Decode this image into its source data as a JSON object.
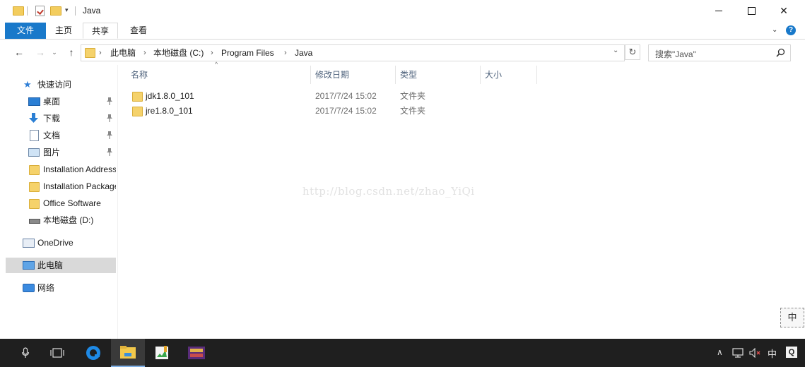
{
  "window": {
    "title": "Java",
    "controls": {
      "minimize": "─",
      "maximize": "☐",
      "close": "✕"
    }
  },
  "ribbon": {
    "tabs": [
      {
        "label": "文件",
        "active": true
      },
      {
        "label": "主页"
      },
      {
        "label": "共享"
      },
      {
        "label": "查看"
      }
    ],
    "help": "?"
  },
  "address": {
    "crumbs": [
      "此电脑",
      "本地磁盘 (C:)",
      "Program Files",
      "Java"
    ],
    "search_placeholder": "搜索\"Java\""
  },
  "nav": {
    "quick_access": "快速访问",
    "items": [
      {
        "label": "桌面",
        "icon": "desktop-icon",
        "pinned": true
      },
      {
        "label": "下载",
        "icon": "download-icon",
        "pinned": true
      },
      {
        "label": "文档",
        "icon": "document-icon",
        "pinned": true
      },
      {
        "label": "图片",
        "icon": "picture-icon",
        "pinned": true
      },
      {
        "label": "Installation Address",
        "icon": "folder-icon"
      },
      {
        "label": "Installation Package",
        "icon": "folder-icon"
      },
      {
        "label": "Office Software",
        "icon": "folder-icon"
      },
      {
        "label": "本地磁盘 (D:)",
        "icon": "drive-icon"
      }
    ],
    "onedrive": "OneDrive",
    "this_pc": "此电脑",
    "network": "网络"
  },
  "list": {
    "columns": [
      "名称",
      "修改日期",
      "类型",
      "大小"
    ],
    "rows": [
      {
        "name": "jdk1.8.0_101",
        "date": "2017/7/24 15:02",
        "type": "文件夹",
        "size": ""
      },
      {
        "name": "jre1.8.0_101",
        "date": "2017/7/24 15:02",
        "type": "文件夹",
        "size": ""
      }
    ]
  },
  "watermark": "http://blog.csdn.net/zhao_YiQi",
  "ime_badge": "中",
  "taskbar": {
    "tray_ime": "中",
    "tray_app": "Q"
  },
  "colors": {
    "ribbon_file_tab": "#1979ca",
    "selected_nav": "#d9d9d9",
    "folder": "#f5d26b",
    "taskbar": "#1f1f1f"
  }
}
